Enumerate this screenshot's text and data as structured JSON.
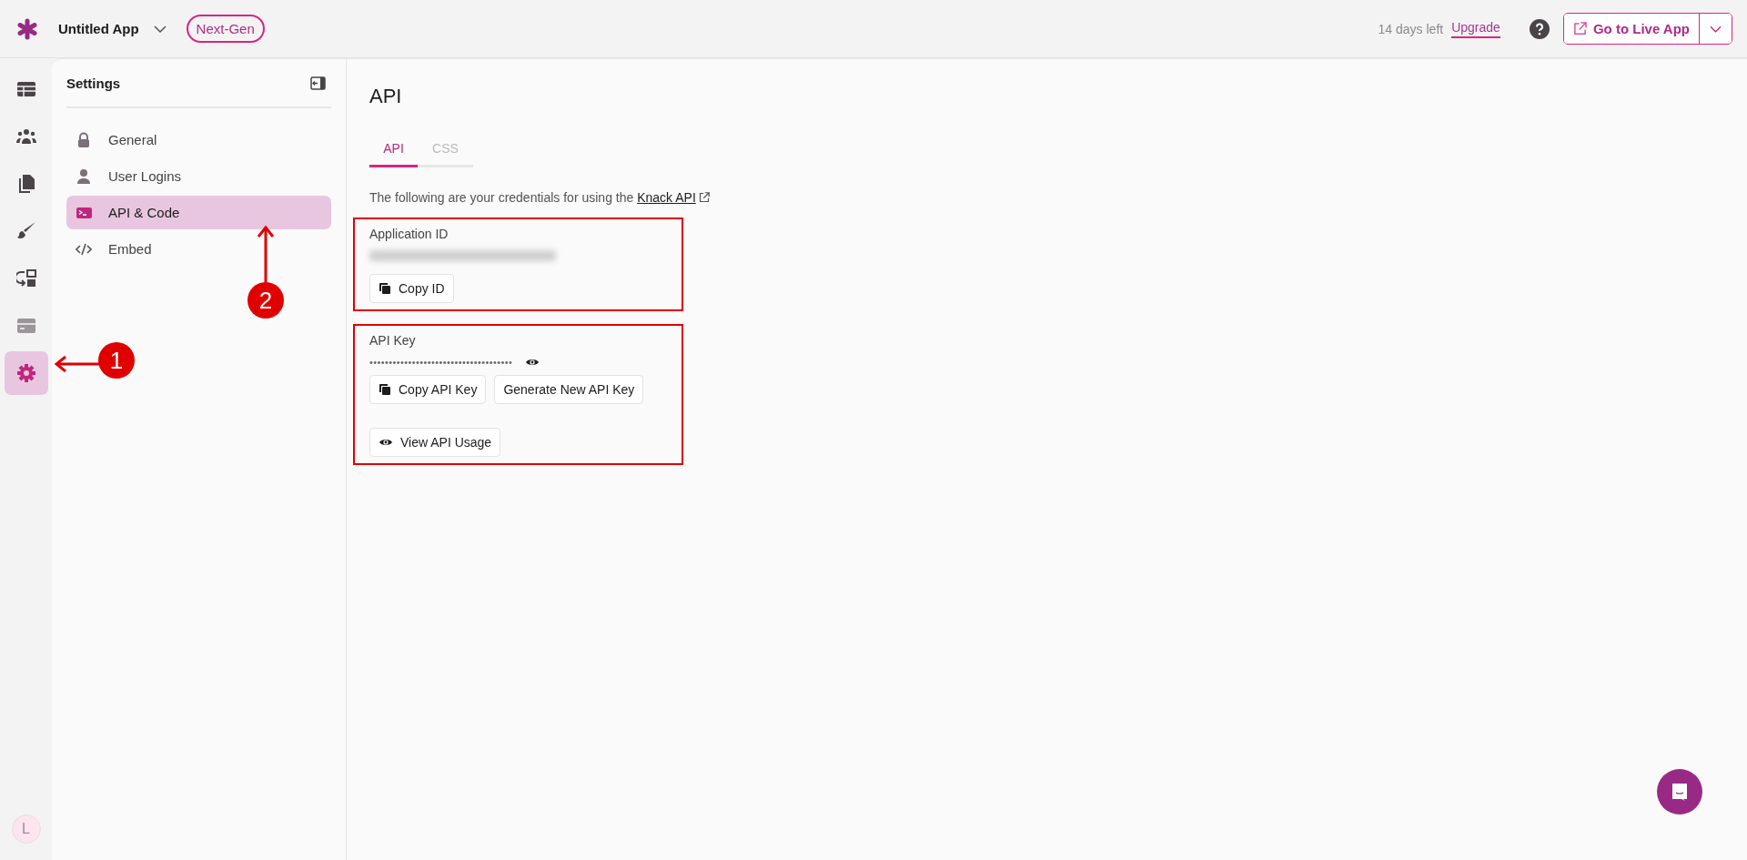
{
  "app": {
    "name": "Untitled App",
    "badge": "Next-Gen"
  },
  "trial": {
    "text": "14 days left",
    "link": "Upgrade"
  },
  "live_button": {
    "label": "Go to Live App"
  },
  "rail": {
    "items": [
      {
        "kind": "table",
        "selected": false
      },
      {
        "kind": "users",
        "selected": false
      },
      {
        "kind": "pages",
        "selected": false
      },
      {
        "kind": "brush",
        "selected": false
      },
      {
        "kind": "flows",
        "selected": false
      },
      {
        "kind": "card",
        "selected": false
      },
      {
        "kind": "gear",
        "selected": true
      }
    ],
    "avatar": "L"
  },
  "settings": {
    "title": "Settings",
    "items": [
      {
        "label": "General",
        "kind": "lock",
        "selected": false
      },
      {
        "label": "User Logins",
        "kind": "user",
        "selected": false
      },
      {
        "label": "API & Code",
        "kind": "terminal",
        "selected": true
      },
      {
        "label": "Embed",
        "kind": "code",
        "selected": false
      }
    ]
  },
  "page": {
    "title": "API",
    "tabs": [
      {
        "label": "API",
        "selected": true
      },
      {
        "label": "CSS",
        "selected": false
      }
    ],
    "intro": "The following are your credentials for using the",
    "intro_link": "Knack API",
    "app_id": {
      "label": "Application ID",
      "buttons": [
        {
          "label": "Copy ID",
          "kind": "copy"
        }
      ]
    },
    "api_key": {
      "label": "API Key",
      "masked": "•••••••••••••••••••••••••••••••••••••",
      "buttons": [
        {
          "label": "Copy API Key",
          "kind": "copy"
        },
        {
          "label": "Generate New API Key",
          "kind": "plain"
        }
      ],
      "usage_button": {
        "label": "View API Usage"
      }
    }
  },
  "annotations": [
    {
      "label": "1",
      "kind": "left"
    },
    {
      "label": "2",
      "kind": "up"
    }
  ]
}
